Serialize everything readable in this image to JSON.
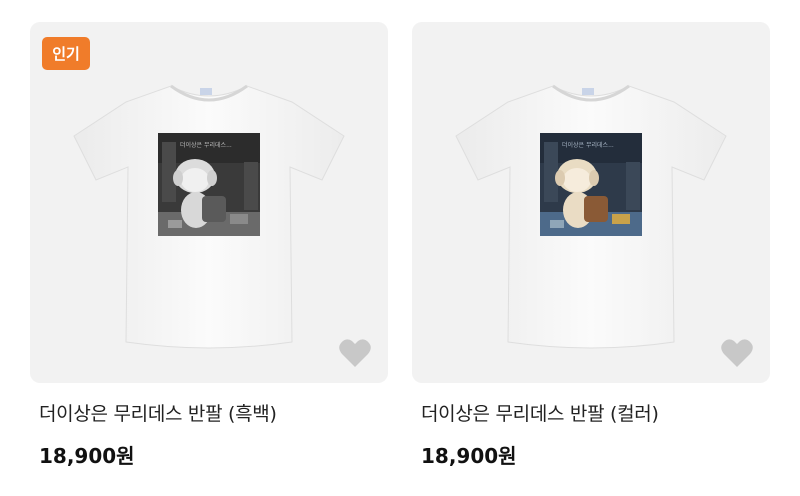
{
  "products": [
    {
      "badge": "인기",
      "title": "더이상은 무리데스 반팔 (흑백)",
      "price": "18,900원",
      "variant": "bw",
      "icons": [
        "heart-icon"
      ]
    },
    {
      "badge": "",
      "title": "더이상은 무리데스 반팔 (컬러)",
      "price": "18,900원",
      "variant": "color",
      "icons": [
        "heart-icon"
      ]
    }
  ],
  "colors": {
    "badge": "#f07c2a",
    "card_bg": "#f2f2f2",
    "heart": "#c8c8c8"
  }
}
